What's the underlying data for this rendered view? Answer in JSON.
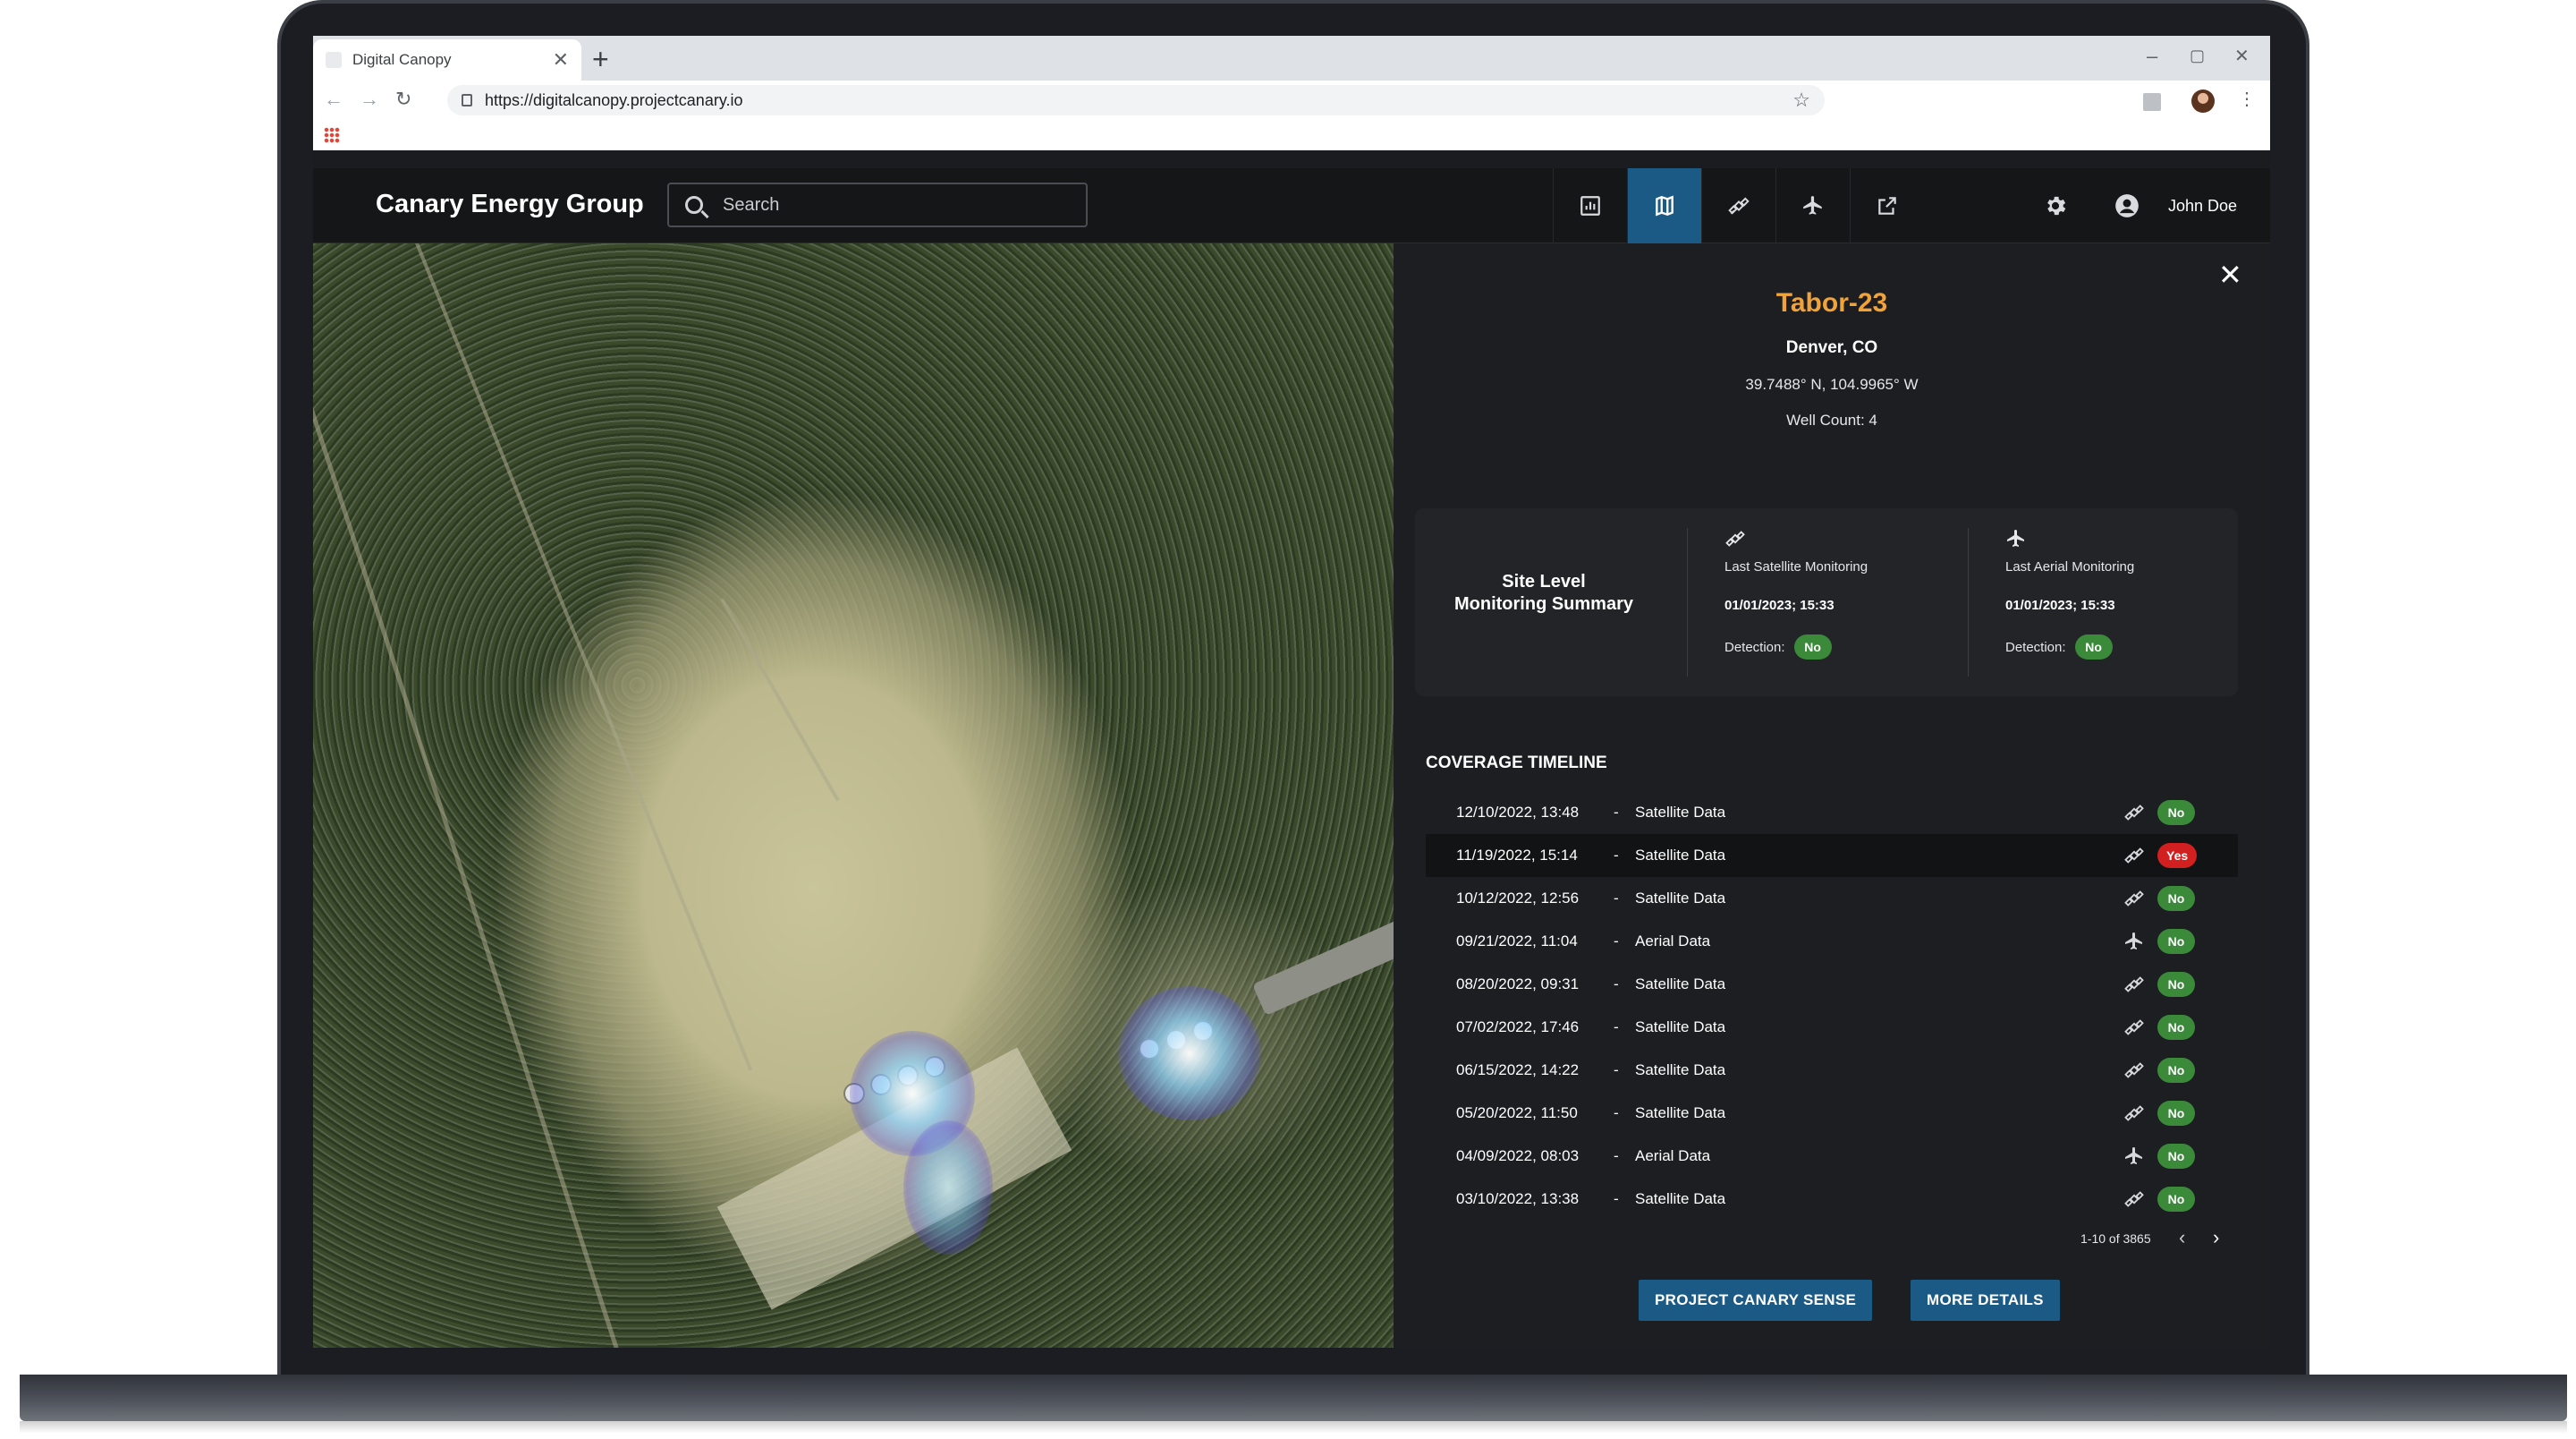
{
  "browser": {
    "tab_title": "Digital Canopy",
    "url": "https://digitalcanopy.projectcanary.io",
    "new_tab": "+",
    "tab_close": "✕"
  },
  "app": {
    "brand": "Canary Energy Group",
    "search_placeholder": "Search",
    "nav_icons": [
      "dashboard-icon",
      "map-icon",
      "satellite-icon",
      "airplane-icon",
      "external-link-icon"
    ],
    "active_nav": "map-icon",
    "user_name": "John Doe",
    "accent_color": "#1c5a86"
  },
  "site": {
    "name": "Tabor-23",
    "location": "Denver, CO",
    "coordinates": "39.7488° N, 104.9965° W",
    "well_count": "Well Count: 4",
    "name_color": "#f0a33a"
  },
  "summary": {
    "title_line1": "Site Level",
    "title_line2": "Monitoring Summary",
    "satellite": {
      "label": "Last Satellite Monitoring",
      "date": "01/01/2023; 15:33",
      "detection_label": "Detection:",
      "detection": "No"
    },
    "aerial": {
      "label": "Last Aerial Monitoring",
      "date": "01/01/2023; 15:33",
      "detection_label": "Detection:",
      "detection": "No"
    }
  },
  "timeline": {
    "title": "COVERAGE TIMELINE",
    "rows": [
      {
        "date": "12/10/2022, 13:48",
        "dash": "-",
        "type": "Satellite Data",
        "icon": "satellite-icon",
        "detection": "No"
      },
      {
        "date": "11/19/2022, 15:14",
        "dash": "-",
        "type": "Satellite Data",
        "icon": "satellite-icon",
        "detection": "Yes"
      },
      {
        "date": "10/12/2022, 12:56",
        "dash": "-",
        "type": "Satellite Data",
        "icon": "satellite-icon",
        "detection": "No"
      },
      {
        "date": "09/21/2022, 11:04",
        "dash": "-",
        "type": "Aerial Data",
        "icon": "airplane-icon",
        "detection": "No"
      },
      {
        "date": "08/20/2022, 09:31",
        "dash": "-",
        "type": "Satellite Data",
        "icon": "satellite-icon",
        "detection": "No"
      },
      {
        "date": "07/02/2022, 17:46",
        "dash": "-",
        "type": "Satellite Data",
        "icon": "satellite-icon",
        "detection": "No"
      },
      {
        "date": "06/15/2022, 14:22",
        "dash": "-",
        "type": "Satellite Data",
        "icon": "satellite-icon",
        "detection": "No"
      },
      {
        "date": "05/20/2022, 11:50",
        "dash": "-",
        "type": "Satellite Data",
        "icon": "satellite-icon",
        "detection": "No"
      },
      {
        "date": "04/09/2022, 08:03",
        "dash": "-",
        "type": "Aerial Data",
        "icon": "airplane-icon",
        "detection": "No"
      },
      {
        "date": "03/10/2022, 13:38",
        "dash": "-",
        "type": "Satellite Data",
        "icon": "satellite-icon",
        "detection": "No"
      }
    ],
    "highlighted_row": 1,
    "pager": "1-10 of 3865",
    "prev": "‹",
    "next": "›"
  },
  "actions": {
    "sense_button": "PROJECT CANARY SENSE",
    "details_button": "MORE DETAILS"
  },
  "colors": {
    "no": "#3a8a3a",
    "yes": "#d21f1f"
  }
}
